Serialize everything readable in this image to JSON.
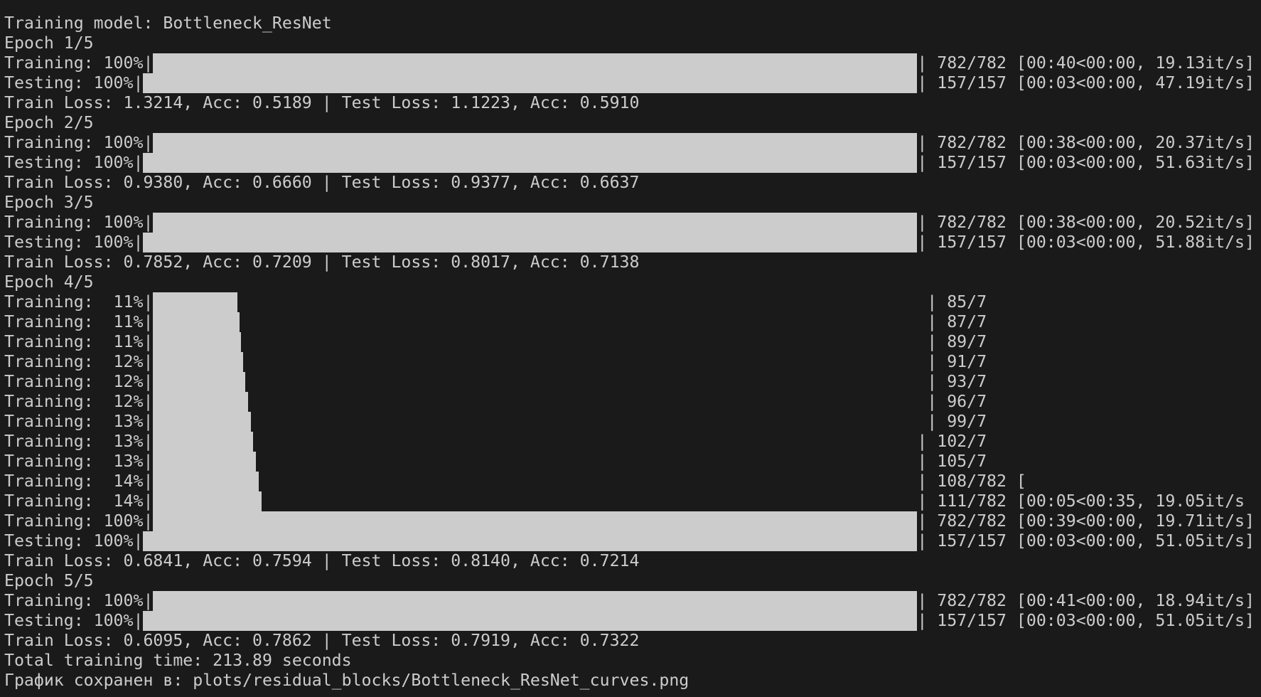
{
  "terminal": {
    "colors": {
      "background": "#1a1a1a",
      "text": "#cccccc",
      "bar": "#cccccc"
    },
    "lines": [
      {
        "kind": "text",
        "text": "Training model: Bottleneck_ResNet"
      },
      {
        "kind": "text",
        "text": "Epoch 1/5"
      },
      {
        "kind": "progress",
        "label": "Training: 100%|",
        "done": 782,
        "total": 782,
        "suffix": "| 782/782 [00:40<00:00, 19.13it/s]"
      },
      {
        "kind": "progress",
        "label": "Testing: 100%|",
        "done": 157,
        "total": 157,
        "suffix": "| 157/157 [00:03<00:00, 47.19it/s]"
      },
      {
        "kind": "text",
        "text": "Train Loss: 1.3214, Acc: 0.5189 | Test Loss: 1.1223, Acc: 0.5910"
      },
      {
        "kind": "text",
        "text": "Epoch 2/5"
      },
      {
        "kind": "progress",
        "label": "Training: 100%|",
        "done": 782,
        "total": 782,
        "suffix": "| 782/782 [00:38<00:00, 20.37it/s]"
      },
      {
        "kind": "progress",
        "label": "Testing: 100%|",
        "done": 157,
        "total": 157,
        "suffix": "| 157/157 [00:03<00:00, 51.63it/s]"
      },
      {
        "kind": "text",
        "text": "Train Loss: 0.9380, Acc: 0.6660 | Test Loss: 0.9377, Acc: 0.6637"
      },
      {
        "kind": "text",
        "text": "Epoch 3/5"
      },
      {
        "kind": "progress",
        "label": "Training: 100%|",
        "done": 782,
        "total": 782,
        "suffix": "| 782/782 [00:38<00:00, 20.52it/s]"
      },
      {
        "kind": "progress",
        "label": "Testing: 100%|",
        "done": 157,
        "total": 157,
        "suffix": "| 157/157 [00:03<00:00, 51.88it/s]"
      },
      {
        "kind": "text",
        "text": "Train Loss: 0.7852, Acc: 0.7209 | Test Loss: 0.8017, Acc: 0.7138"
      },
      {
        "kind": "text",
        "text": "Epoch 4/5"
      },
      {
        "kind": "progress",
        "label": "Training:  11%|",
        "done": 85,
        "total": 782,
        "suffix": "| 85/7"
      },
      {
        "kind": "progress",
        "label": "Training:  11%|",
        "done": 87,
        "total": 782,
        "suffix": "| 87/7"
      },
      {
        "kind": "progress",
        "label": "Training:  11%|",
        "done": 89,
        "total": 782,
        "suffix": "| 89/7"
      },
      {
        "kind": "progress",
        "label": "Training:  12%|",
        "done": 91,
        "total": 782,
        "suffix": "| 91/7"
      },
      {
        "kind": "progress",
        "label": "Training:  12%|",
        "done": 93,
        "total": 782,
        "suffix": "| 93/7"
      },
      {
        "kind": "progress",
        "label": "Training:  12%|",
        "done": 96,
        "total": 782,
        "suffix": "| 96/7"
      },
      {
        "kind": "progress",
        "label": "Training:  13%|",
        "done": 99,
        "total": 782,
        "suffix": "| 99/7"
      },
      {
        "kind": "progress",
        "label": "Training:  13%|",
        "done": 102,
        "total": 782,
        "suffix": "| 102/7"
      },
      {
        "kind": "progress",
        "label": "Training:  13%|",
        "done": 105,
        "total": 782,
        "suffix": "| 105/7"
      },
      {
        "kind": "progress",
        "label": "Training:  14%|",
        "done": 108,
        "total": 782,
        "suffix": "| 108/782 ["
      },
      {
        "kind": "progress",
        "label": "Training:  14%|",
        "done": 111,
        "total": 782,
        "suffix": "| 111/782 [00:05<00:35, 19.05it/s"
      },
      {
        "kind": "progress",
        "label": "Training: 100%|",
        "done": 782,
        "total": 782,
        "suffix": "| 782/782 [00:39<00:00, 19.71it/s]"
      },
      {
        "kind": "progress",
        "label": "Testing: 100%|",
        "done": 157,
        "total": 157,
        "suffix": "| 157/157 [00:03<00:00, 51.05it/s]"
      },
      {
        "kind": "text",
        "text": "Train Loss: 0.6841, Acc: 0.7594 | Test Loss: 0.8140, Acc: 0.7214"
      },
      {
        "kind": "text",
        "text": "Epoch 5/5"
      },
      {
        "kind": "progress",
        "label": "Training: 100%|",
        "done": 782,
        "total": 782,
        "suffix": "| 782/782 [00:41<00:00, 18.94it/s]"
      },
      {
        "kind": "progress",
        "label": "Testing: 100%|",
        "done": 157,
        "total": 157,
        "suffix": "| 157/157 [00:03<00:00, 51.05it/s]"
      },
      {
        "kind": "text",
        "text": "Train Loss: 0.6095, Acc: 0.7862 | Test Loss: 0.7919, Acc: 0.7322"
      },
      {
        "kind": "text",
        "text": "Total training time: 213.89 seconds"
      },
      {
        "kind": "text",
        "text": "График сохранен в: plots/residual_blocks/Bottleneck_ResNet_curves.png"
      }
    ]
  }
}
